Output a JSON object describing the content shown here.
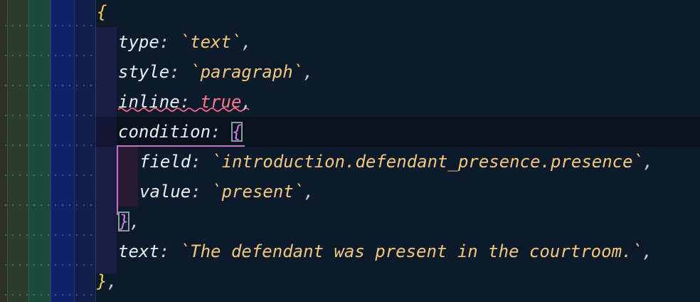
{
  "code": {
    "open_brace": "{",
    "type_key": "type",
    "type_value": "`text`",
    "style_key": "style",
    "style_value": "`paragraph`",
    "inline_key": "inline",
    "inline_value": "true",
    "condition_key": "condition",
    "condition_open": "{",
    "field_key": "field",
    "field_value": "`introduction.defendant_presence.presence`",
    "value_key": "value",
    "value_value": "`present`",
    "condition_close": "}",
    "text_key": "text",
    "text_value": "`The defendant was present in the courtroom.`",
    "close_brace": "}",
    "colon": ":",
    "comma": ","
  },
  "colors": {
    "background": "#0c1a29",
    "string": "#f0c880",
    "boolean": "#ff7a90",
    "brace": "#f5d34c",
    "scope": "#c772c7",
    "diagnostic": "#ff6b8a"
  }
}
